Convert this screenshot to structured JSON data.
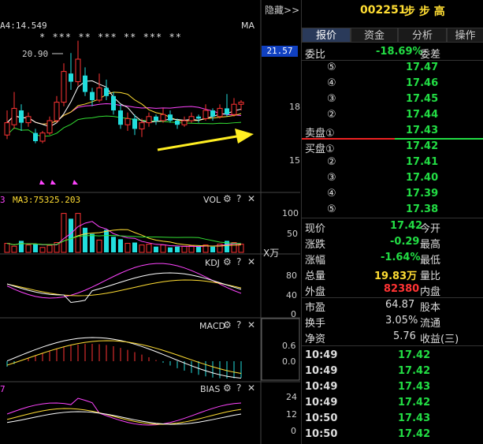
{
  "header": {
    "hide_label": "隐藏",
    "hide_arrow": ">>",
    "badge": "R",
    "stock_code": "002251",
    "stock_name": "步 步 高"
  },
  "tabs": [
    {
      "label": "报价",
      "active": true
    },
    {
      "label": "资金",
      "active": false
    },
    {
      "label": "分析",
      "active": false
    },
    {
      "label": "操作",
      "active": false
    }
  ],
  "main_chart": {
    "ma_label": "A4:14.549",
    "ma_tag": "MA",
    "stars": "*  ***  **  ***  **    ***    **",
    "high_label": "20.90",
    "price_ticks": [
      "18",
      "15"
    ],
    "current_price_tag": "21.57",
    "candles": [
      {
        "o": 16.3,
        "c": 16.9,
        "h": 17.5,
        "l": 16.1
      },
      {
        "o": 16.8,
        "c": 17.6,
        "h": 18.4,
        "l": 16.6
      },
      {
        "o": 17.5,
        "c": 16.9,
        "h": 17.8,
        "l": 16.5
      },
      {
        "o": 16.9,
        "c": 17.2,
        "h": 17.4,
        "l": 16.7
      },
      {
        "o": 16.4,
        "c": 16.0,
        "h": 16.6,
        "l": 15.9
      },
      {
        "o": 16.0,
        "c": 16.4,
        "h": 16.5,
        "l": 15.9
      },
      {
        "o": 16.4,
        "c": 17.0,
        "h": 17.2,
        "l": 16.3
      },
      {
        "o": 17.0,
        "c": 17.9,
        "h": 18.2,
        "l": 16.9
      },
      {
        "o": 17.9,
        "c": 19.4,
        "h": 19.8,
        "l": 17.7
      },
      {
        "o": 19.3,
        "c": 18.9,
        "h": 20.3,
        "l": 18.5
      },
      {
        "o": 18.9,
        "c": 20.0,
        "h": 20.9,
        "l": 18.7
      },
      {
        "o": 19.2,
        "c": 18.4,
        "h": 19.6,
        "l": 18.2
      },
      {
        "o": 18.4,
        "c": 18.0,
        "h": 18.6,
        "l": 17.7
      },
      {
        "o": 18.0,
        "c": 18.6,
        "h": 19.3,
        "l": 17.9
      },
      {
        "o": 18.6,
        "c": 18.2,
        "h": 19.0,
        "l": 18.0
      },
      {
        "o": 18.2,
        "c": 17.5,
        "h": 18.4,
        "l": 17.3
      },
      {
        "o": 17.5,
        "c": 16.8,
        "h": 17.8,
        "l": 16.6
      },
      {
        "o": 16.8,
        "c": 17.1,
        "h": 17.4,
        "l": 16.5
      },
      {
        "o": 17.1,
        "c": 16.6,
        "h": 17.3,
        "l": 16.3
      },
      {
        "o": 16.6,
        "c": 16.9,
        "h": 17.1,
        "l": 16.2
      },
      {
        "o": 16.9,
        "c": 17.2,
        "h": 17.4,
        "l": 16.7
      },
      {
        "o": 17.2,
        "c": 17.0,
        "h": 17.3,
        "l": 16.8
      },
      {
        "o": 17.0,
        "c": 17.3,
        "h": 17.6,
        "l": 16.9
      },
      {
        "o": 17.3,
        "c": 17.0,
        "h": 17.5,
        "l": 16.9
      },
      {
        "o": 17.0,
        "c": 16.8,
        "h": 17.1,
        "l": 16.6
      },
      {
        "o": 16.8,
        "c": 17.0,
        "h": 17.2,
        "l": 16.7
      },
      {
        "o": 17.0,
        "c": 17.2,
        "h": 17.4,
        "l": 16.9
      },
      {
        "o": 17.2,
        "c": 17.1,
        "h": 17.3,
        "l": 16.9
      },
      {
        "o": 17.1,
        "c": 17.5,
        "h": 17.8,
        "l": 17.0
      },
      {
        "o": 17.5,
        "c": 17.2,
        "h": 17.6,
        "l": 17.0
      },
      {
        "o": 17.2,
        "c": 17.6,
        "h": 17.8,
        "l": 17.1
      },
      {
        "o": 17.6,
        "c": 17.3,
        "h": 18.3,
        "l": 17.2
      },
      {
        "o": 17.3,
        "c": 17.8,
        "h": 18.1,
        "l": 17.2
      },
      {
        "o": 17.8,
        "c": 17.9,
        "h": 18.0,
        "l": 17.5
      }
    ]
  },
  "vol_panel": {
    "ma_label": "MA3:75325.203",
    "left_mark": "3",
    "title": "VOL",
    "ticks": [
      "100",
      "50"
    ],
    "unit": "X万",
    "values": [
      22,
      15,
      28,
      18,
      20,
      12,
      17,
      24,
      95,
      82,
      95,
      60,
      45,
      30,
      55,
      38,
      32,
      22,
      24,
      18,
      20,
      14,
      18,
      12,
      14,
      15,
      16,
      14,
      18,
      14,
      20,
      28,
      24,
      20
    ]
  },
  "kdj_panel": {
    "title": "KDJ",
    "ticks": [
      "80",
      "40",
      "0"
    ]
  },
  "macd_panel": {
    "title": "MACD",
    "ticks": [
      "0.6",
      "0.0"
    ]
  },
  "bias_panel": {
    "left_mark": "7",
    "title": "BIAS",
    "ticks": [
      "24",
      "12",
      "0"
    ]
  },
  "quote": {
    "webi_label": "委比",
    "webi_value": "-18.69%",
    "weicha_label": "委差",
    "ask": [
      {
        "label": "⑤",
        "price": "17.47"
      },
      {
        "label": "④",
        "price": "17.46"
      },
      {
        "label": "③",
        "price": "17.45"
      },
      {
        "label": "②",
        "price": "17.44"
      },
      {
        "label": "卖盘①",
        "price": "17.43"
      }
    ],
    "bid": [
      {
        "label": "买盘①",
        "price": "17.42"
      },
      {
        "label": "②",
        "price": "17.41"
      },
      {
        "label": "③",
        "price": "17.40"
      },
      {
        "label": "④",
        "price": "17.39"
      },
      {
        "label": "⑤",
        "price": "17.38"
      }
    ],
    "stats": [
      {
        "label": "现价",
        "value": "17.42",
        "right": "今开",
        "color": "g"
      },
      {
        "label": "涨跌",
        "value": "-0.29",
        "right": "最高",
        "color": "g"
      },
      {
        "label": "涨幅",
        "value": "-1.64%",
        "right": "最低",
        "color": "g"
      },
      {
        "label": "总量",
        "value": "19.83万",
        "right": "量比",
        "color": "y"
      },
      {
        "label": "外盘",
        "value": "82380",
        "right": "内盘",
        "color": "r"
      }
    ],
    "fundamentals": [
      {
        "label": "市盈",
        "value": "64.87",
        "right": "股本"
      },
      {
        "label": "换手",
        "value": "3.05%",
        "right": "流通"
      },
      {
        "label": "净资",
        "value": "5.76",
        "right": "收益(三)"
      }
    ],
    "ticks": [
      {
        "time": "10:49",
        "price": "17.42"
      },
      {
        "time": "10:49",
        "price": "17.42"
      },
      {
        "time": "10:49",
        "price": "17.43"
      },
      {
        "time": "10:49",
        "price": "17.42"
      },
      {
        "time": "10:50",
        "price": "17.43"
      },
      {
        "time": "10:50",
        "price": "17.42"
      }
    ]
  },
  "colors": {
    "up": "#ff3333",
    "down": "#22dddd",
    "ma5": "#ffffff",
    "ma10": "#ffdd33",
    "ma20": "#ff44ff",
    "ma30": "#33dd33",
    "arrow": "#ffee22"
  }
}
